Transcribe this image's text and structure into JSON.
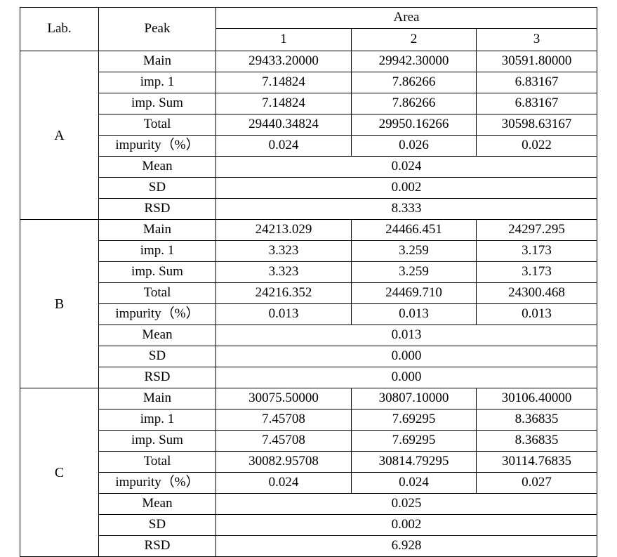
{
  "table": {
    "headers": {
      "lab": "Lab.",
      "peak": "Peak",
      "area": "Area",
      "area_cols": [
        "1",
        "2",
        "3"
      ]
    },
    "peak_labels": {
      "main": "Main",
      "imp1": "imp. 1",
      "imp_sum": "imp. Sum",
      "total": "Total",
      "impurity_pct": "impurity（%）",
      "mean": "Mean",
      "sd": "SD",
      "rsd": "RSD"
    },
    "sections": [
      {
        "lab": "A",
        "rows": [
          {
            "label": "Main",
            "values": [
              "29433.20000",
              "29942.30000",
              "30591.80000"
            ]
          },
          {
            "label": "imp. 1",
            "values": [
              "7.14824",
              "7.86266",
              "6.83167"
            ]
          },
          {
            "label": "imp. Sum",
            "values": [
              "7.14824",
              "7.86266",
              "6.83167"
            ]
          },
          {
            "label": "Total",
            "values": [
              "29440.34824",
              "29950.16266",
              "30598.63167"
            ]
          },
          {
            "label": "impurity（%）",
            "values": [
              "0.024",
              "0.026",
              "0.022"
            ]
          }
        ],
        "stats": [
          {
            "label": "Mean",
            "value": "0.024"
          },
          {
            "label": "SD",
            "value": "0.002"
          },
          {
            "label": "RSD",
            "value": "8.333"
          }
        ]
      },
      {
        "lab": "B",
        "rows": [
          {
            "label": "Main",
            "values": [
              "24213.029",
              "24466.451",
              "24297.295"
            ]
          },
          {
            "label": "imp. 1",
            "values": [
              "3.323",
              "3.259",
              "3.173"
            ]
          },
          {
            "label": "imp. Sum",
            "values": [
              "3.323",
              "3.259",
              "3.173"
            ]
          },
          {
            "label": "Total",
            "values": [
              "24216.352",
              "24469.710",
              "24300.468"
            ]
          },
          {
            "label": "impurity（%）",
            "values": [
              "0.013",
              "0.013",
              "0.013"
            ]
          }
        ],
        "stats": [
          {
            "label": "Mean",
            "value": "0.013"
          },
          {
            "label": "SD",
            "value": "0.000"
          },
          {
            "label": "RSD",
            "value": "0.000"
          }
        ]
      },
      {
        "lab": "C",
        "rows": [
          {
            "label": "Main",
            "values": [
              "30075.50000",
              "30807.10000",
              "30106.40000"
            ]
          },
          {
            "label": "imp. 1",
            "values": [
              "7.45708",
              "7.69295",
              "8.36835"
            ]
          },
          {
            "label": "imp. Sum",
            "values": [
              "7.45708",
              "7.69295",
              "8.36835"
            ]
          },
          {
            "label": "Total",
            "values": [
              "30082.95708",
              "30814.79295",
              "30114.76835"
            ]
          },
          {
            "label": "impurity（%）",
            "values": [
              "0.024",
              "0.024",
              "0.027"
            ]
          }
        ],
        "stats": [
          {
            "label": "Mean",
            "value": "0.025"
          },
          {
            "label": "SD",
            "value": "0.002"
          },
          {
            "label": "RSD",
            "value": "6.928"
          }
        ]
      }
    ]
  }
}
